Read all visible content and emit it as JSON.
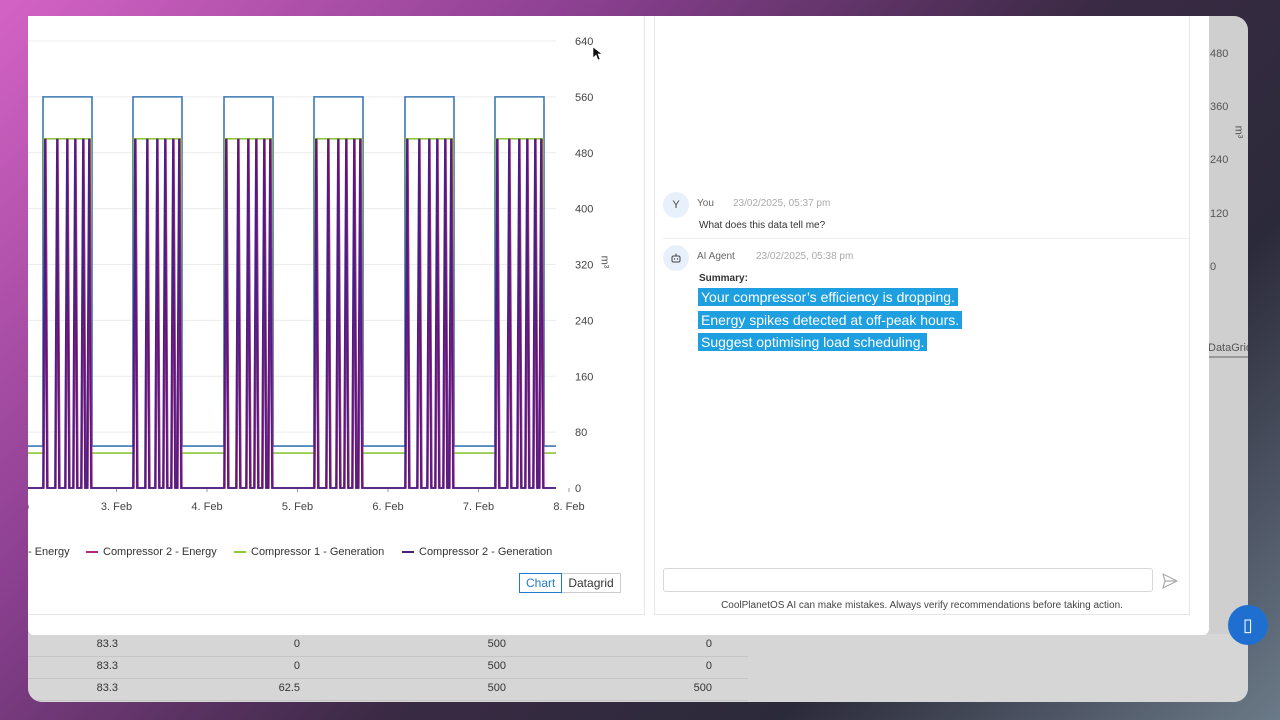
{
  "background": {
    "axis_ticks": [
      "480",
      "360",
      "240",
      "120",
      "0"
    ],
    "axis_unit": "m³",
    "datagrid_tab": "DataGrid",
    "rows": [
      [
        "83.3",
        "0",
        "500",
        "0"
      ],
      [
        "83.3",
        "0",
        "500",
        "0"
      ],
      [
        "83.3",
        "62.5",
        "500",
        "500"
      ]
    ]
  },
  "chart": {
    "legend": [
      "- Energy",
      "Compressor 2 - Energy",
      "Compressor 1 - Generation",
      "Compressor 2 - Generation"
    ],
    "view_toggle": {
      "chart_label": "Chart",
      "datagrid_label": "Datagrid",
      "active": "Chart"
    }
  },
  "chart_data": {
    "type": "line",
    "x_tick_labels": [
      "b",
      "3. Feb",
      "4. Feb",
      "5. Feb",
      "6. Feb",
      "7. Feb",
      "8. Feb"
    ],
    "y_tick_labels": [
      "0",
      "80",
      "160",
      "240",
      "320",
      "400",
      "480",
      "560",
      "640"
    ],
    "ylabel": "m³",
    "ylim": [
      0,
      640
    ],
    "grid": true,
    "legend_position": "bottom",
    "series": [
      {
        "name": "- Energy",
        "color": "#3a78b4",
        "pattern": "square wave 560 high, 60 low, daily"
      },
      {
        "name": "Compressor 2 - Energy",
        "color": "#b0287a",
        "pattern": "spikes to 500 during high periods, 0 otherwise"
      },
      {
        "name": "Compressor 1 - Generation",
        "color": "#8cc63f",
        "pattern": "square wave 500 high, 50 low, daily"
      },
      {
        "name": "Compressor 2 - Generation",
        "color": "#4b1e84",
        "pattern": "spikes to 500 during high periods, 0 otherwise"
      }
    ]
  },
  "chat": {
    "messages": [
      {
        "avatar": "Y",
        "author": "You",
        "time": "23/02/2025, 05:37 pm",
        "text": "What does this data tell me?"
      },
      {
        "avatar_icon": "robot-icon",
        "author": "AI Agent",
        "time": "23/02/2025, 05:38 pm",
        "summary_label": "Summary:",
        "highlights": [
          "Your compressor’s efficiency is dropping.",
          "Energy spikes detected at off-peak hours.",
          "Suggest optimising load scheduling."
        ]
      }
    ],
    "input_placeholder": "",
    "disclaimer": "CoolPlanetOS AI can make mistakes. Always verify recommendations before taking action."
  }
}
